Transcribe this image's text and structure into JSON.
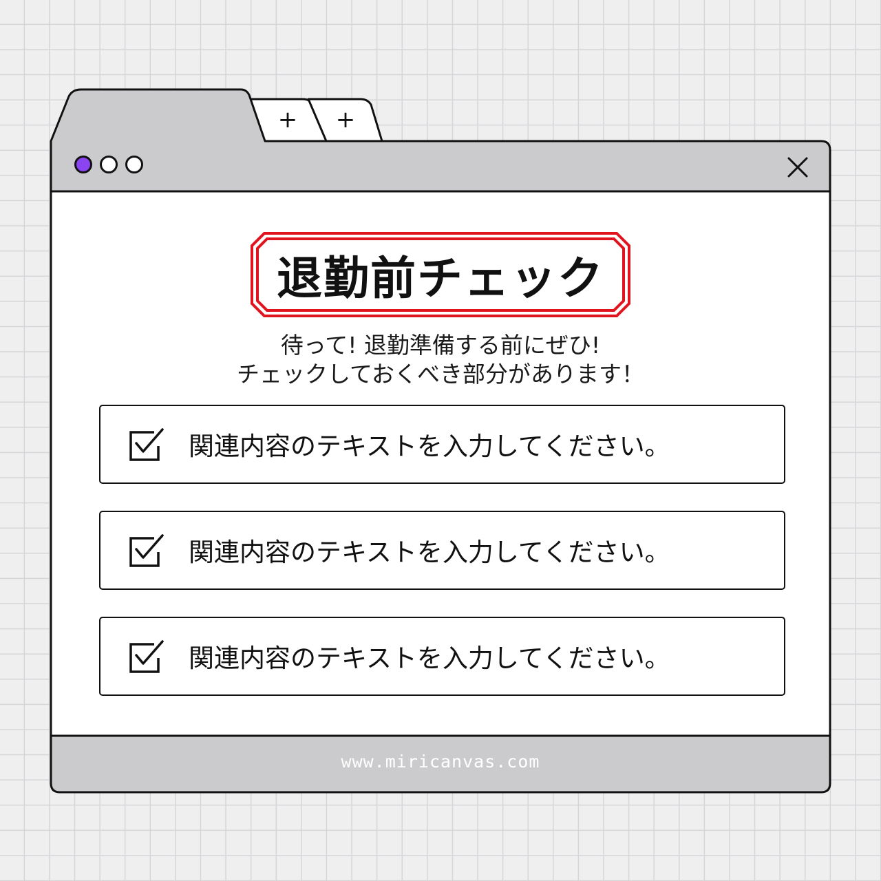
{
  "window": {
    "tabs": [
      {
        "label": "+",
        "icon": "plus-icon"
      },
      {
        "label": "+",
        "icon": "plus-icon"
      }
    ],
    "traffic_lights": [
      {
        "color": "#8b45f0"
      },
      {
        "color": "#ffffff"
      },
      {
        "color": "#ffffff"
      }
    ],
    "close_icon": "close-icon",
    "chrome_color": "#cbcbcd",
    "accent_color": "#8b45f0"
  },
  "main": {
    "title": "退勤前チェック",
    "title_border_color": "#e0141e",
    "subtitle_line1": "待って! 退勤準備する前にぜひ!",
    "subtitle_line2": "チェックしておくべき部分があります！",
    "checklist": [
      {
        "label": "関連内容のテキストを入力してください。",
        "checked": true
      },
      {
        "label": "関連内容のテキストを入力してください。",
        "checked": true
      },
      {
        "label": "関連内容のテキストを入力してください。",
        "checked": true
      }
    ]
  },
  "footer": {
    "url": "www.miricanvas.com"
  }
}
